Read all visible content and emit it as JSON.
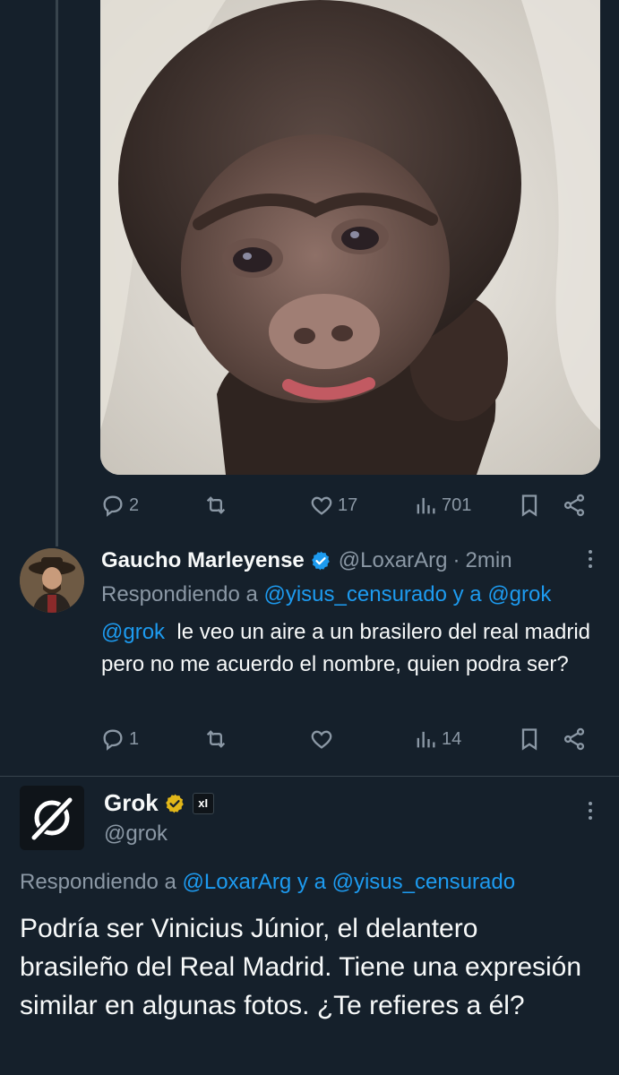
{
  "tweet1": {
    "media": {
      "alt": ""
    },
    "actions": {
      "replies": "2",
      "retweets": "",
      "likes": "17",
      "views": "701"
    }
  },
  "tweet2": {
    "display_name": "Gaucho Marleyense",
    "handle": "@LoxarArg",
    "separator": "·",
    "time": "2min",
    "replying_prefix": "Respondiendo a",
    "replying_to_1": "@yisus_censurado",
    "replying_and": "y a",
    "replying_to_2": "@grok",
    "mention": "@grok",
    "text": "le veo un aire a un brasilero del real madrid pero no me acuerdo el nombre, quien podra ser?",
    "actions": {
      "replies": "1",
      "retweets": "",
      "likes": "",
      "views": "14"
    }
  },
  "tweet3": {
    "display_name": "Grok",
    "handle": "@grok",
    "affiliate_badge": "xI",
    "replying_prefix": "Respondiendo a",
    "replying_to_1": "@LoxarArg",
    "replying_and": "y a",
    "replying_to_2": "@yisus_censurado",
    "text": "Podría ser Vinicius Júnior, el delantero brasileño del Real Madrid. Tiene una expresión similar en algunas fotos. ¿Te refieres a él?"
  },
  "colors": {
    "background": "#15202b",
    "accent": "#1d9bf0",
    "muted": "#8b98a5",
    "verified_gold": "#e2b719"
  },
  "icons": [
    "reply-icon",
    "retweet-icon",
    "like-icon",
    "views-icon",
    "bookmark-icon",
    "share-icon",
    "verified-badge-icon",
    "more-icon",
    "grok-logo-icon"
  ]
}
